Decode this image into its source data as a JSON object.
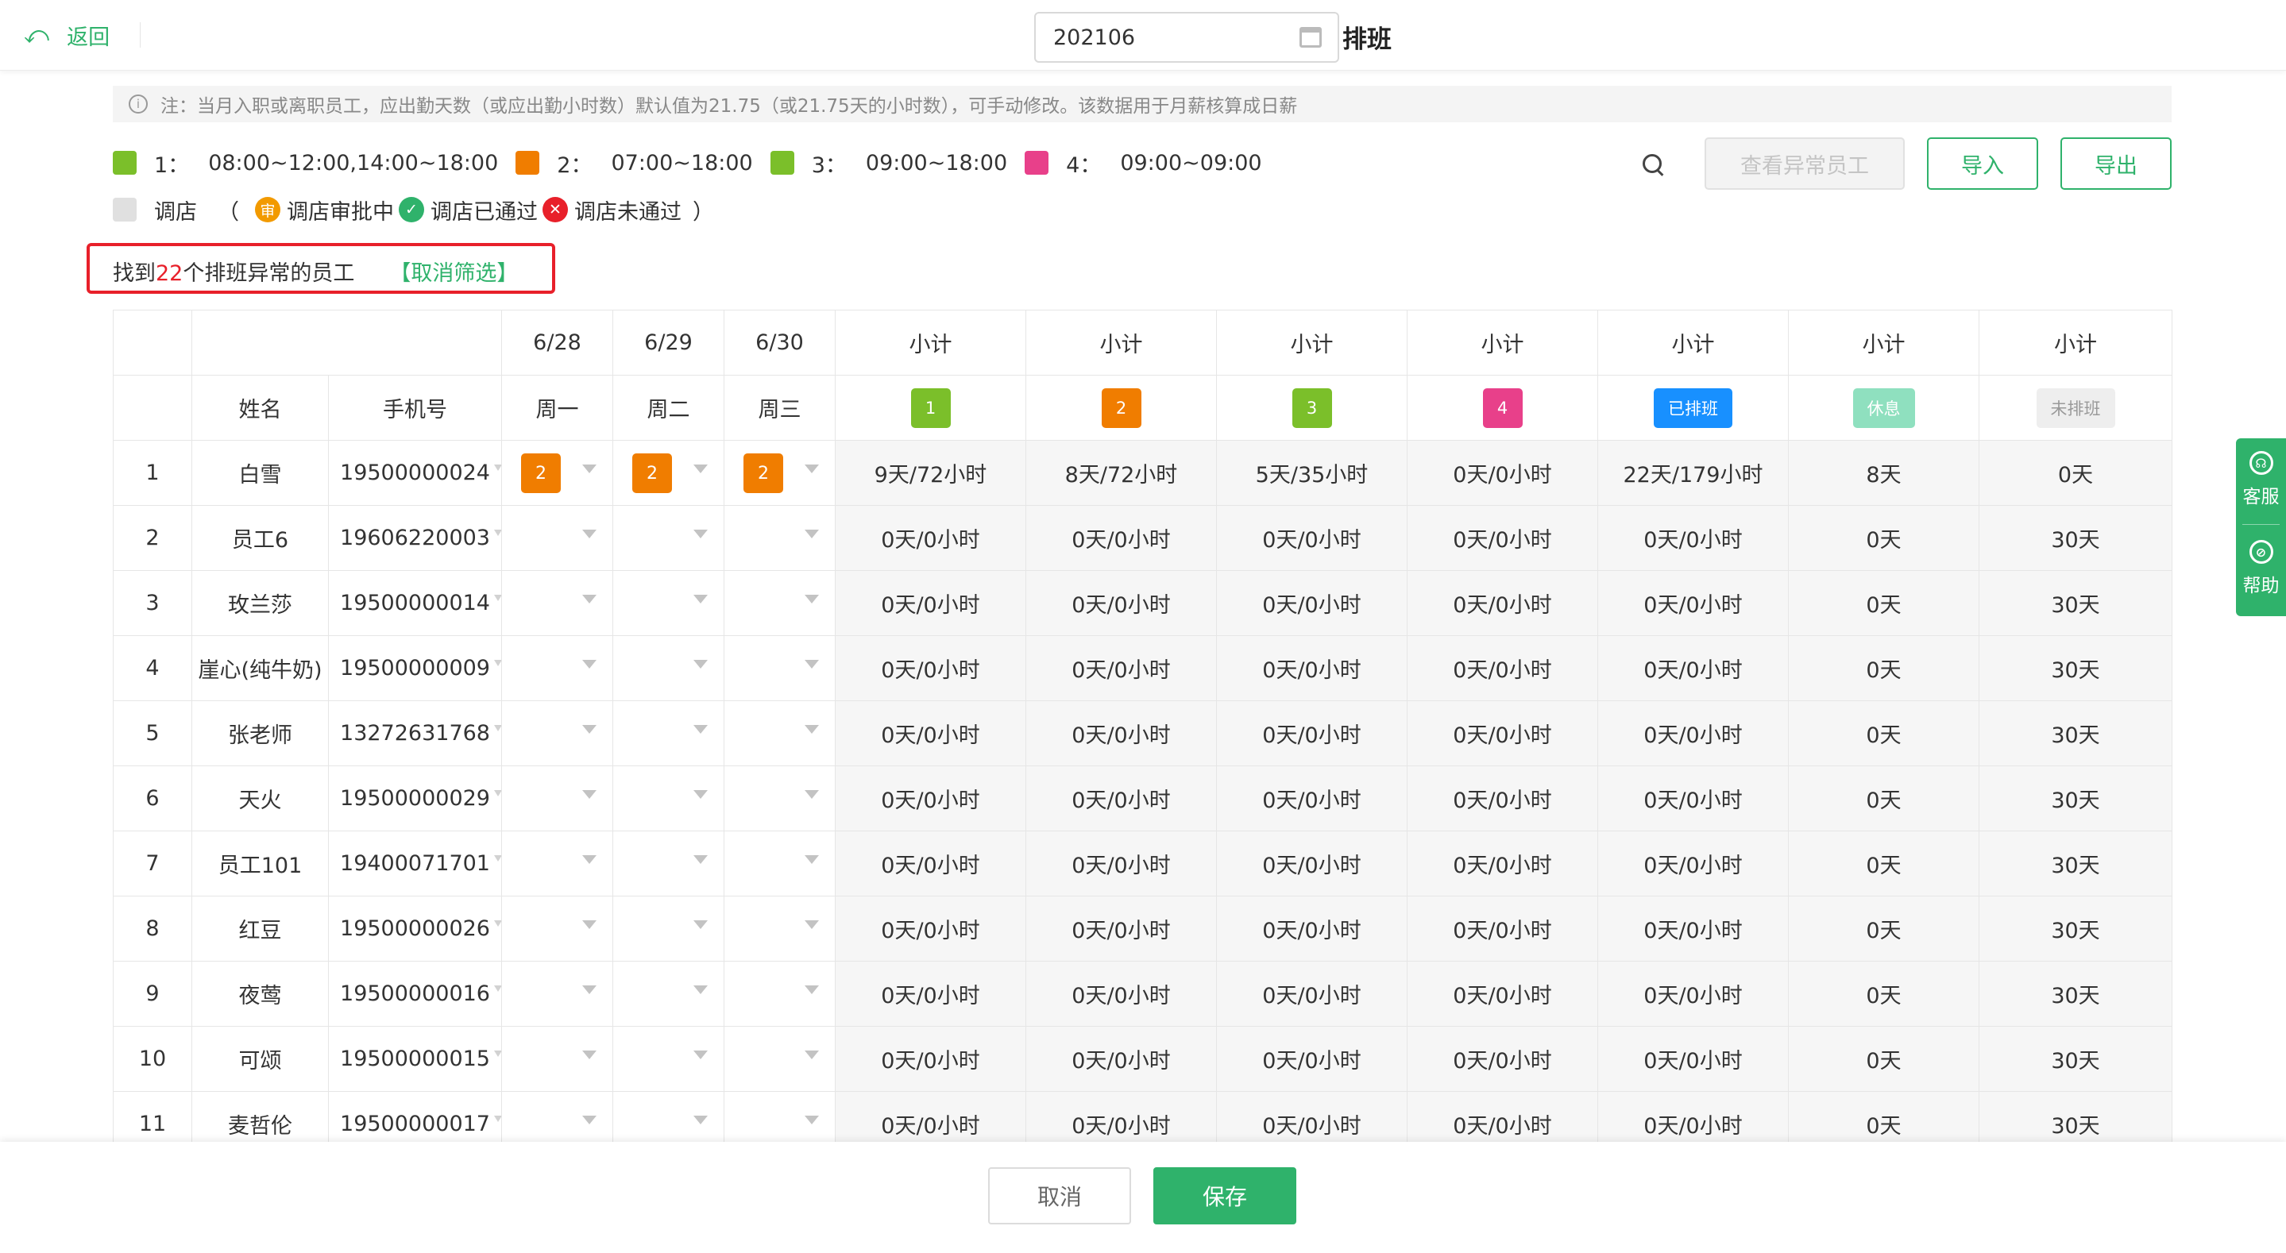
{
  "topbar": {
    "back_label": "返回",
    "month": "202106",
    "title": "排班"
  },
  "notice": "注：当月入职或离职员工，应出勤天数（或应出勤小时数）默认值为21.75（或21.75天的小时数），可手动修改。该数据用于月薪核算成日薪",
  "legend": {
    "shifts": [
      {
        "num": "1：",
        "time": "08:00~12:00,14:00~18:00",
        "color": "#7bbf2a"
      },
      {
        "num": "2：",
        "time": "07:00~18:00",
        "color": "#f07d00"
      },
      {
        "num": "3：",
        "time": "09:00~18:00",
        "color": "#7bbf2a"
      },
      {
        "num": "4：",
        "time": "09:00~09:00",
        "color": "#e8408a"
      }
    ],
    "transfer_label": "调店",
    "open_paren": "（",
    "pending_icon": "审",
    "pending_label": "调店审批中",
    "approved_label": "调店已通过",
    "rejected_label": "调店未通过",
    "close_paren": "）"
  },
  "actions": {
    "abnormal": "查看异常员工",
    "import": "导入",
    "export": "导出"
  },
  "filter": {
    "prefix": "找到",
    "count": "22",
    "suffix": "个排班异常的员工",
    "cancel": "【取消筛选】"
  },
  "table": {
    "dates": [
      "6/28",
      "6/29",
      "6/30"
    ],
    "weekdays": [
      "周一",
      "周二",
      "周三"
    ],
    "subtotal": "小计",
    "col_name": "姓名",
    "col_phone": "手机号",
    "badges": [
      {
        "label": "1",
        "color": "#7bbf2a"
      },
      {
        "label": "2",
        "color": "#f07d00"
      },
      {
        "label": "3",
        "color": "#7bbf2a"
      },
      {
        "label": "4",
        "color": "#e8408a"
      },
      {
        "label": "已排班",
        "color": "#1890ff"
      },
      {
        "label": "休息",
        "color": "#8fe0bf"
      },
      {
        "label": "未排班",
        "color": "#eeeeee",
        "text_color": "#999999"
      }
    ],
    "rows": [
      {
        "no": "1",
        "name": "白雪",
        "phone": "19500000024",
        "shifts": [
          "2",
          "2",
          "2"
        ],
        "s1": "9天/72小时",
        "s2": "8天/72小时",
        "s3": "5天/35小时",
        "s4": "0天/0小时",
        "scheduled": "22天/179小时",
        "rest": "8天",
        "unscheduled": "0天"
      },
      {
        "no": "2",
        "name": "员工6",
        "phone": "19606220003",
        "shifts": [
          "",
          "",
          ""
        ],
        "s1": "0天/0小时",
        "s2": "0天/0小时",
        "s3": "0天/0小时",
        "s4": "0天/0小时",
        "scheduled": "0天/0小时",
        "rest": "0天",
        "unscheduled": "30天"
      },
      {
        "no": "3",
        "name": "玫兰莎",
        "phone": "19500000014",
        "shifts": [
          "",
          "",
          ""
        ],
        "s1": "0天/0小时",
        "s2": "0天/0小时",
        "s3": "0天/0小时",
        "s4": "0天/0小时",
        "scheduled": "0天/0小时",
        "rest": "0天",
        "unscheduled": "30天"
      },
      {
        "no": "4",
        "name": "崖心(纯牛奶)",
        "phone": "19500000009",
        "shifts": [
          "",
          "",
          ""
        ],
        "s1": "0天/0小时",
        "s2": "0天/0小时",
        "s3": "0天/0小时",
        "s4": "0天/0小时",
        "scheduled": "0天/0小时",
        "rest": "0天",
        "unscheduled": "30天"
      },
      {
        "no": "5",
        "name": "张老师",
        "phone": "13272631768",
        "shifts": [
          "",
          "",
          ""
        ],
        "s1": "0天/0小时",
        "s2": "0天/0小时",
        "s3": "0天/0小时",
        "s4": "0天/0小时",
        "scheduled": "0天/0小时",
        "rest": "0天",
        "unscheduled": "30天"
      },
      {
        "no": "6",
        "name": "天火",
        "phone": "19500000029",
        "shifts": [
          "",
          "",
          ""
        ],
        "s1": "0天/0小时",
        "s2": "0天/0小时",
        "s3": "0天/0小时",
        "s4": "0天/0小时",
        "scheduled": "0天/0小时",
        "rest": "0天",
        "unscheduled": "30天"
      },
      {
        "no": "7",
        "name": "员工101",
        "phone": "19400071701",
        "shifts": [
          "",
          "",
          ""
        ],
        "s1": "0天/0小时",
        "s2": "0天/0小时",
        "s3": "0天/0小时",
        "s4": "0天/0小时",
        "scheduled": "0天/0小时",
        "rest": "0天",
        "unscheduled": "30天"
      },
      {
        "no": "8",
        "name": "红豆",
        "phone": "19500000026",
        "shifts": [
          "",
          "",
          ""
        ],
        "s1": "0天/0小时",
        "s2": "0天/0小时",
        "s3": "0天/0小时",
        "s4": "0天/0小时",
        "scheduled": "0天/0小时",
        "rest": "0天",
        "unscheduled": "30天"
      },
      {
        "no": "9",
        "name": "夜莺",
        "phone": "19500000016",
        "shifts": [
          "",
          "",
          ""
        ],
        "s1": "0天/0小时",
        "s2": "0天/0小时",
        "s3": "0天/0小时",
        "s4": "0天/0小时",
        "scheduled": "0天/0小时",
        "rest": "0天",
        "unscheduled": "30天"
      },
      {
        "no": "10",
        "name": "可颂",
        "phone": "19500000015",
        "shifts": [
          "",
          "",
          ""
        ],
        "s1": "0天/0小时",
        "s2": "0天/0小时",
        "s3": "0天/0小时",
        "s4": "0天/0小时",
        "scheduled": "0天/0小时",
        "rest": "0天",
        "unscheduled": "30天"
      },
      {
        "no": "11",
        "name": "麦哲伦",
        "phone": "19500000017",
        "shifts": [
          "",
          "",
          ""
        ],
        "s1": "0天/0小时",
        "s2": "0天/0小时",
        "s3": "0天/0小时",
        "s4": "0天/0小时",
        "scheduled": "0天/0小时",
        "rest": "0天",
        "unscheduled": "30天"
      }
    ]
  },
  "float": {
    "service": "客服",
    "help": "帮助"
  },
  "bottom": {
    "cancel": "取消",
    "save": "保存"
  },
  "colors": {
    "accent": "#2fb26b",
    "danger": "#e8202a",
    "shift_orange": "#f07d00"
  }
}
